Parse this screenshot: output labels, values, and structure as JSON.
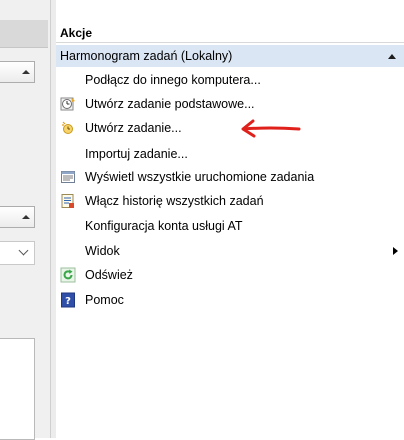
{
  "actions_pane": {
    "title": "Akcje",
    "section": {
      "title": "Harmonogram zadań (Lokalny)"
    },
    "items": [
      {
        "label": "Podłącz do innego komputera...",
        "icon": "none"
      },
      {
        "label": "Utwórz zadanie podstawowe...",
        "icon": "clock-wizard-icon"
      },
      {
        "label": "Utwórz zadanie...",
        "icon": "new-task-icon"
      },
      {
        "label": "Importuj zadanie...",
        "icon": "none"
      },
      {
        "label": "Wyświetl wszystkie uruchomione zadania",
        "icon": "task-list-icon"
      },
      {
        "label": "Włącz historię wszystkich zadań",
        "icon": "history-icon"
      },
      {
        "label": "Konfiguracja konta usługi AT",
        "icon": "none"
      },
      {
        "label": "Widok",
        "icon": "none",
        "submenu": true
      },
      {
        "label": "Odśwież",
        "icon": "refresh-icon"
      },
      {
        "label": "Pomoc",
        "icon": "help-icon"
      }
    ]
  },
  "annotation": {
    "color": "#e0201b",
    "target": "Utwórz zadanie..."
  },
  "colors": {
    "section_header_bg": "#dbe6f4",
    "left_pane_bg": "#f0f0f0",
    "help_icon_blue": "#2f4fa8",
    "refresh_green": "#3aa64a"
  }
}
